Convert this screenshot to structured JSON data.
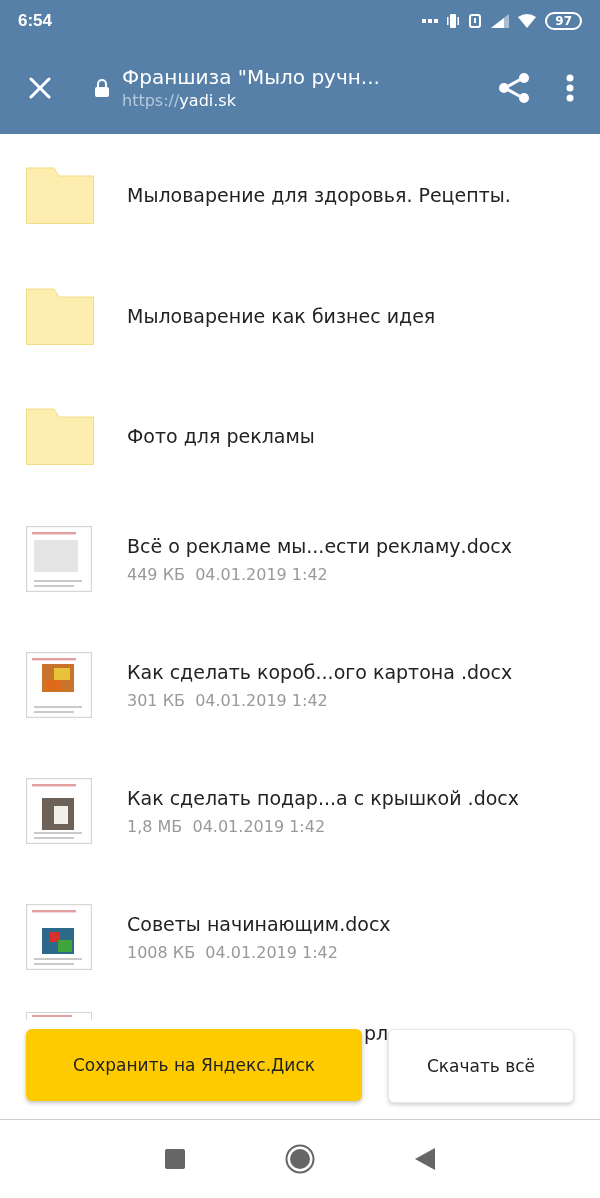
{
  "status_bar": {
    "time": "6:54",
    "battery": "97"
  },
  "header": {
    "title": "Франшиза \"Мыло ручн...",
    "url_scheme": "https://",
    "url_host": "yadi.sk"
  },
  "items": [
    {
      "kind": "folder",
      "name": "Мыловарение для здоровья. Рецепты."
    },
    {
      "kind": "folder",
      "name": "Мыловарение как бизнес идея"
    },
    {
      "kind": "folder",
      "name": "Фото для рекламы"
    },
    {
      "kind": "file",
      "name": "Всё о рекламе мы...ести рекламу.docx",
      "size": "449 КБ",
      "date": "04.01.2019  1:42"
    },
    {
      "kind": "file",
      "name": "Как сделать короб...ого картона .docx",
      "size": "301 КБ",
      "date": "04.01.2019  1:42"
    },
    {
      "kind": "file",
      "name": "Как сделать подар...а с крышкой .docx",
      "size": "1,8 МБ",
      "date": "04.01.2019  1:42"
    },
    {
      "kind": "file",
      "name": "Советы начинающим.docx",
      "size": "1008 КБ",
      "date": "04.01.2019  1:42"
    },
    {
      "kind": "partial",
      "name": "рл"
    }
  ],
  "actions": {
    "save": "Сохранить на Яндекс.Диск",
    "download": "Скачать всё"
  }
}
